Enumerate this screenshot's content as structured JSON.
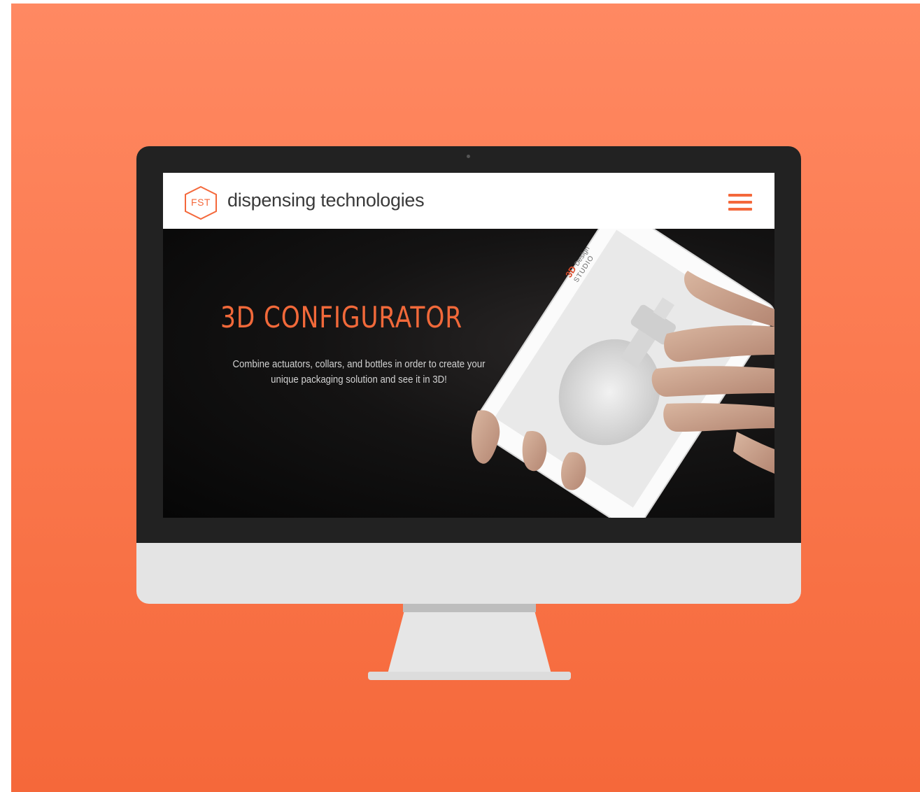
{
  "site": {
    "logo_text": "FST",
    "brand_name": "dispensing technologies"
  },
  "hero": {
    "title": "3D CONFIGURATOR",
    "subtitle_line1": "Combine actuators, collars, and bottles in order to create your",
    "subtitle_line2": "unique packaging solution and see it in 3D!"
  },
  "tablet_screen": {
    "brand_main": "3D",
    "brand_secondary": "Design",
    "brand_tertiary": "STUDIO"
  },
  "icons": {
    "menu": "hamburger-menu-icon",
    "logo": "hexagon-logo-icon"
  },
  "colors": {
    "accent": "#f4683b",
    "background": "#fb7a50",
    "hero_bg": "#0b0b0b"
  }
}
